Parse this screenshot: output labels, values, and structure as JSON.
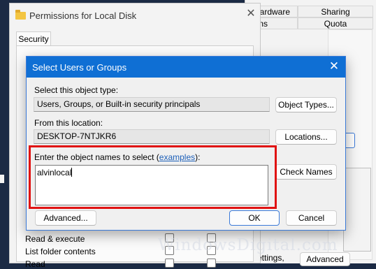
{
  "background_window": {
    "tabs_row1": [
      "Hardware",
      "Sharing"
    ],
    "tabs_row2": [
      "sions",
      "Quota"
    ],
    "bottom_text": "ettings,",
    "bottom_button": "Advanced"
  },
  "permissions_window": {
    "title": "Permissions for Local Disk",
    "tab": "Security",
    "rows": [
      "Read & execute",
      "List folder contents",
      "Read"
    ]
  },
  "dialog": {
    "title": "Select Users or Groups",
    "object_type_label": "Select this object type:",
    "object_type_value": "Users, Groups, or Built-in security principals",
    "object_types_button": "Object Types...",
    "location_label": "From this location:",
    "location_value": "DESKTOP-7NTJKR6",
    "locations_button": "Locations...",
    "names_label_prefix": "Enter the object names to select (",
    "names_label_link": "examples",
    "names_label_suffix": "):",
    "names_value": "alvinlocal",
    "check_names_button": "Check Names",
    "advanced_button": "Advanced...",
    "ok_button": "OK",
    "cancel_button": "Cancel"
  },
  "watermark": "WindowsDigital.com",
  "colors": {
    "title_bar": "#0f6fd4",
    "highlight_frame": "#e01313",
    "link": "#1c5fb8"
  }
}
